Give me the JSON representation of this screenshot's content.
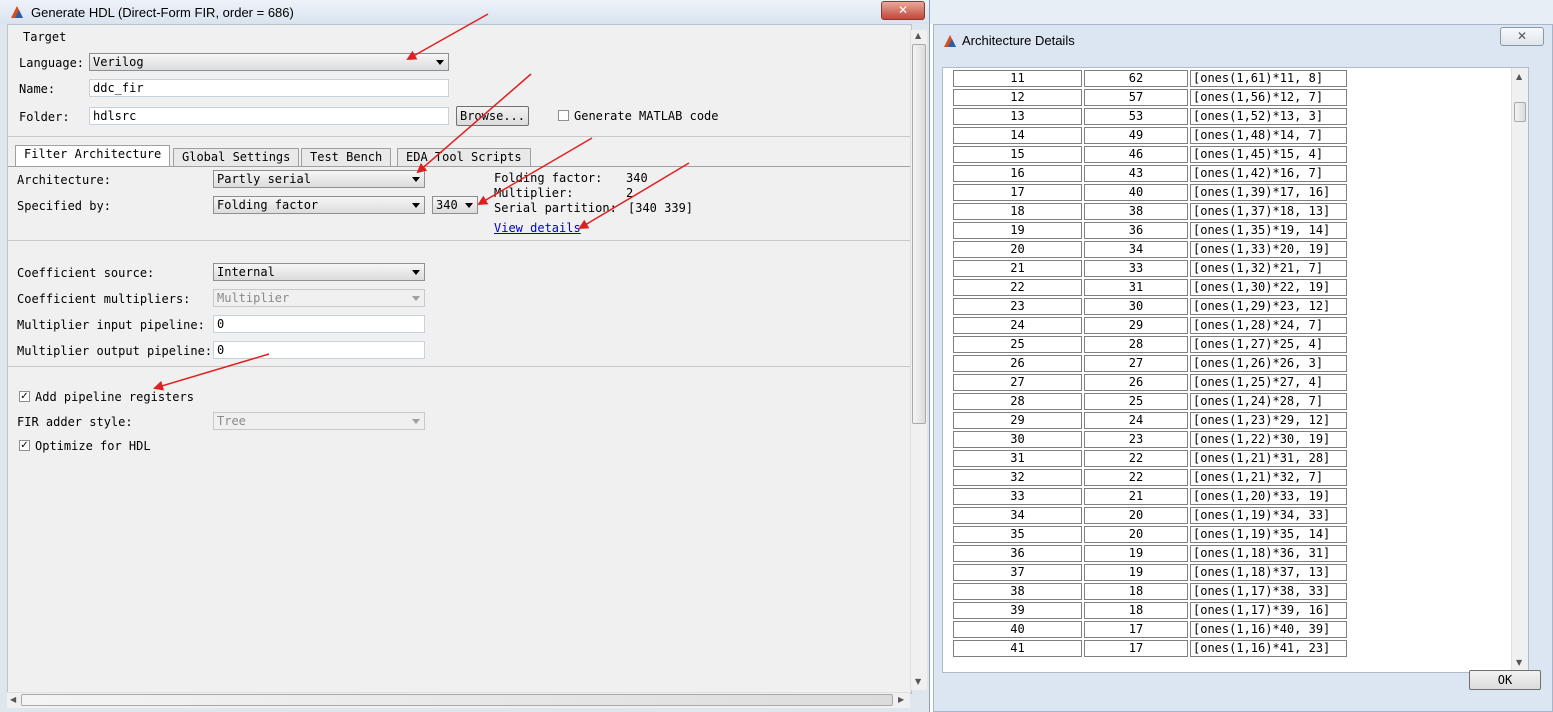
{
  "main_window": {
    "title": "Generate HDL (Direct-Form FIR, order = 686)",
    "close_label": "✕"
  },
  "target": {
    "group_label": "Target",
    "language_label": "Language:",
    "language_value": "Verilog",
    "name_label": "Name:",
    "name_value": "ddc_fir",
    "folder_label": "Folder:",
    "folder_value": "hdlsrc",
    "browse_label": "Browse...",
    "generate_matlab_label": "Generate MATLAB code",
    "generate_matlab_checked": false
  },
  "tabs": [
    {
      "label": "Filter Architecture",
      "active": true
    },
    {
      "label": "Global Settings",
      "active": false
    },
    {
      "label": "Test Bench",
      "active": false
    },
    {
      "label": "EDA Tool Scripts",
      "active": false
    }
  ],
  "filter_architecture": {
    "architecture_label": "Architecture:",
    "architecture_value": "Partly serial",
    "specified_by_label": "Specified by:",
    "specified_by_value": "Folding factor",
    "folding_value": "340",
    "folding_factor_label": "Folding factor:",
    "folding_factor_value": "340",
    "multiplier_label": "Multiplier:",
    "multiplier_value": "2",
    "serial_partition_label": "Serial partition:",
    "serial_partition_value": "[340 339]",
    "view_details_label": "View details",
    "coefficient_source_label": "Coefficient source:",
    "coefficient_source_value": "Internal",
    "coefficient_multipliers_label": "Coefficient multipliers:",
    "coefficient_multipliers_value": "Multiplier",
    "mult_input_pipeline_label": "Multiplier input pipeline:",
    "mult_input_pipeline_value": "0",
    "mult_output_pipeline_label": "Multiplier output pipeline:",
    "mult_output_pipeline_value": "0",
    "add_pipeline_label": "Add pipeline registers",
    "add_pipeline_checked": true,
    "fir_adder_label": "FIR adder style:",
    "fir_adder_value": "Tree",
    "optimize_label": "Optimize for HDL",
    "optimize_checked": true
  },
  "details_window": {
    "title": "Architecture Details",
    "close_label": "✕",
    "ok_label": "OK",
    "rows": [
      [
        "11",
        "62",
        "[ones(1,61)*11, 8]"
      ],
      [
        "12",
        "57",
        "[ones(1,56)*12, 7]"
      ],
      [
        "13",
        "53",
        "[ones(1,52)*13, 3]"
      ],
      [
        "14",
        "49",
        "[ones(1,48)*14, 7]"
      ],
      [
        "15",
        "46",
        "[ones(1,45)*15, 4]"
      ],
      [
        "16",
        "43",
        "[ones(1,42)*16, 7]"
      ],
      [
        "17",
        "40",
        "[ones(1,39)*17, 16]"
      ],
      [
        "18",
        "38",
        "[ones(1,37)*18, 13]"
      ],
      [
        "19",
        "36",
        "[ones(1,35)*19, 14]"
      ],
      [
        "20",
        "34",
        "[ones(1,33)*20, 19]"
      ],
      [
        "21",
        "33",
        "[ones(1,32)*21, 7]"
      ],
      [
        "22",
        "31",
        "[ones(1,30)*22, 19]"
      ],
      [
        "23",
        "30",
        "[ones(1,29)*23, 12]"
      ],
      [
        "24",
        "29",
        "[ones(1,28)*24, 7]"
      ],
      [
        "25",
        "28",
        "[ones(1,27)*25, 4]"
      ],
      [
        "26",
        "27",
        "[ones(1,26)*26, 3]"
      ],
      [
        "27",
        "26",
        "[ones(1,25)*27, 4]"
      ],
      [
        "28",
        "25",
        "[ones(1,24)*28, 7]"
      ],
      [
        "29",
        "24",
        "[ones(1,23)*29, 12]"
      ],
      [
        "30",
        "23",
        "[ones(1,22)*30, 19]"
      ],
      [
        "31",
        "22",
        "[ones(1,21)*31, 28]"
      ],
      [
        "32",
        "22",
        "[ones(1,21)*32, 7]"
      ],
      [
        "33",
        "21",
        "[ones(1,20)*33, 19]"
      ],
      [
        "34",
        "20",
        "[ones(1,19)*34, 33]"
      ],
      [
        "35",
        "20",
        "[ones(1,19)*35, 14]"
      ],
      [
        "36",
        "19",
        "[ones(1,18)*36, 31]"
      ],
      [
        "37",
        "19",
        "[ones(1,18)*37, 13]"
      ],
      [
        "38",
        "18",
        "[ones(1,17)*38, 33]"
      ],
      [
        "39",
        "18",
        "[ones(1,17)*39, 16]"
      ],
      [
        "40",
        "17",
        "[ones(1,16)*40, 39]"
      ],
      [
        "41",
        "17",
        "[ones(1,16)*41, 23]"
      ]
    ]
  },
  "colors": {
    "annotation_arrow": "#e02020",
    "link": "#0000cc",
    "close_button": "#c0473a"
  }
}
